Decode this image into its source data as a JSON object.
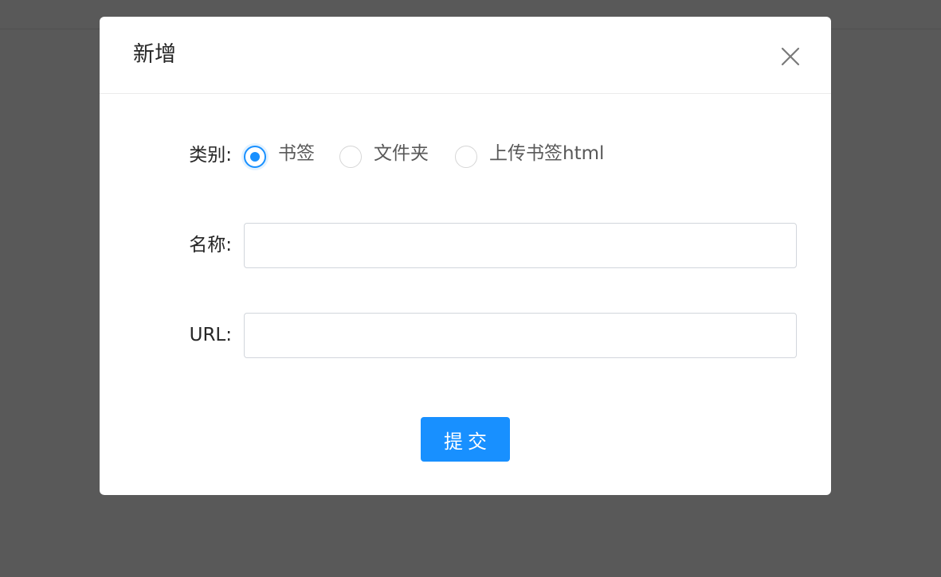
{
  "modal": {
    "title": "新增",
    "close_icon": "close-icon"
  },
  "form": {
    "category": {
      "label": "类别",
      "options": [
        {
          "label": "书签",
          "checked": true
        },
        {
          "label": "文件夹",
          "checked": false
        },
        {
          "label": "上传书签html",
          "checked": false
        }
      ]
    },
    "name": {
      "label": "名称",
      "value": "",
      "placeholder": ""
    },
    "url": {
      "label": "URL",
      "value": "",
      "placeholder": ""
    },
    "submit_label": "提交"
  },
  "colors": {
    "primary": "#1890ff",
    "overlay": "#595959",
    "text": "#262626"
  }
}
